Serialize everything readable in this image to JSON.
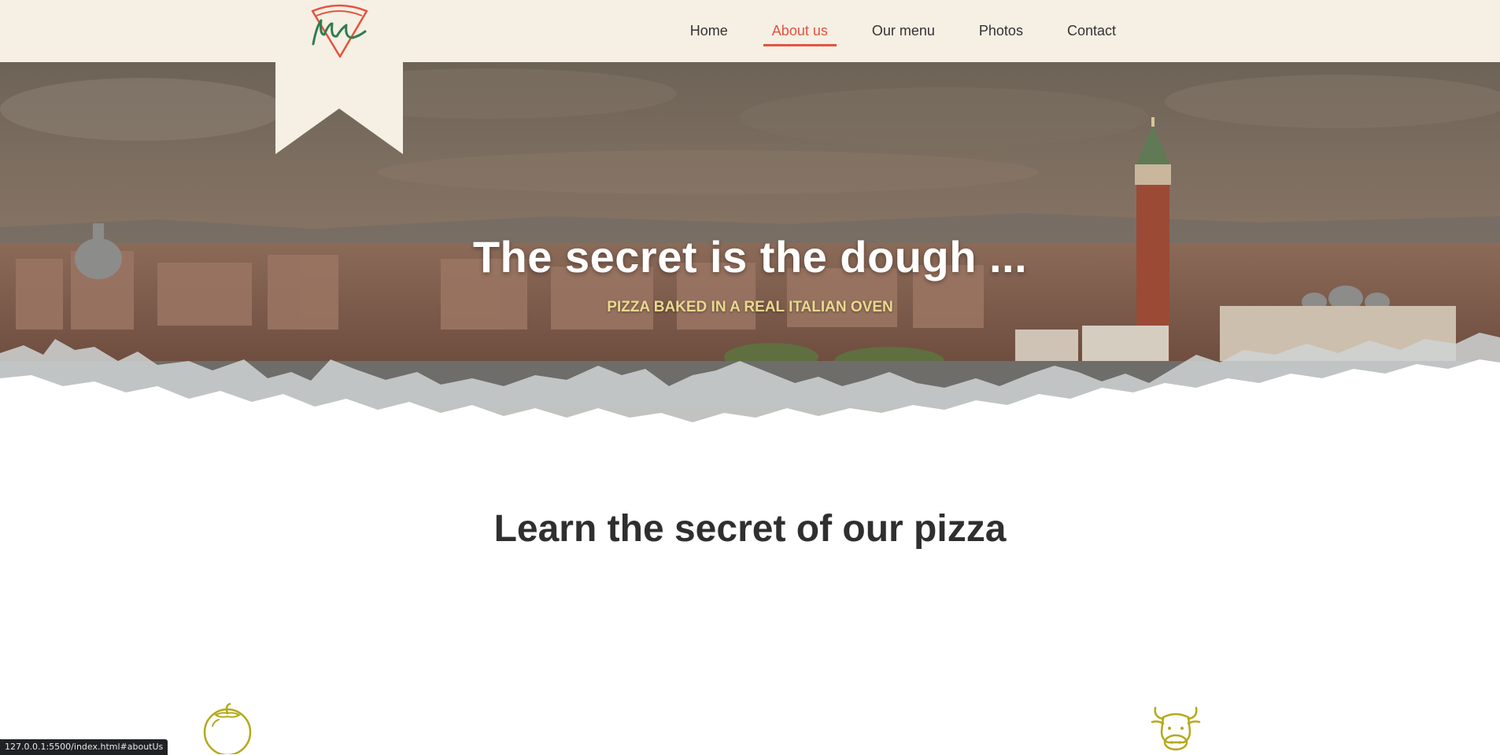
{
  "nav": {
    "items": [
      {
        "label": "Home",
        "active": false
      },
      {
        "label": "About us",
        "active": true
      },
      {
        "label": "Our menu",
        "active": false
      },
      {
        "label": "Photos",
        "active": false
      },
      {
        "label": "Contact",
        "active": false
      }
    ]
  },
  "hero": {
    "title": "The secret is the dough ...",
    "subtitle": "PIZZA BAKED IN A REAL ITALIAN OVEN"
  },
  "section": {
    "title": "Learn the secret of our pizza"
  },
  "status": {
    "url": "127.0.0.1:5500/index.html#aboutUs"
  },
  "icons": [
    "pizza-logo-icon",
    "tomato-icon",
    "cow-icon"
  ],
  "colors": {
    "accent": "#e4533f",
    "header_bg": "#f6efe4",
    "logo_green": "#2e7d4f",
    "subtitle": "#ead98e",
    "icon_olive": "#b5a91a"
  }
}
